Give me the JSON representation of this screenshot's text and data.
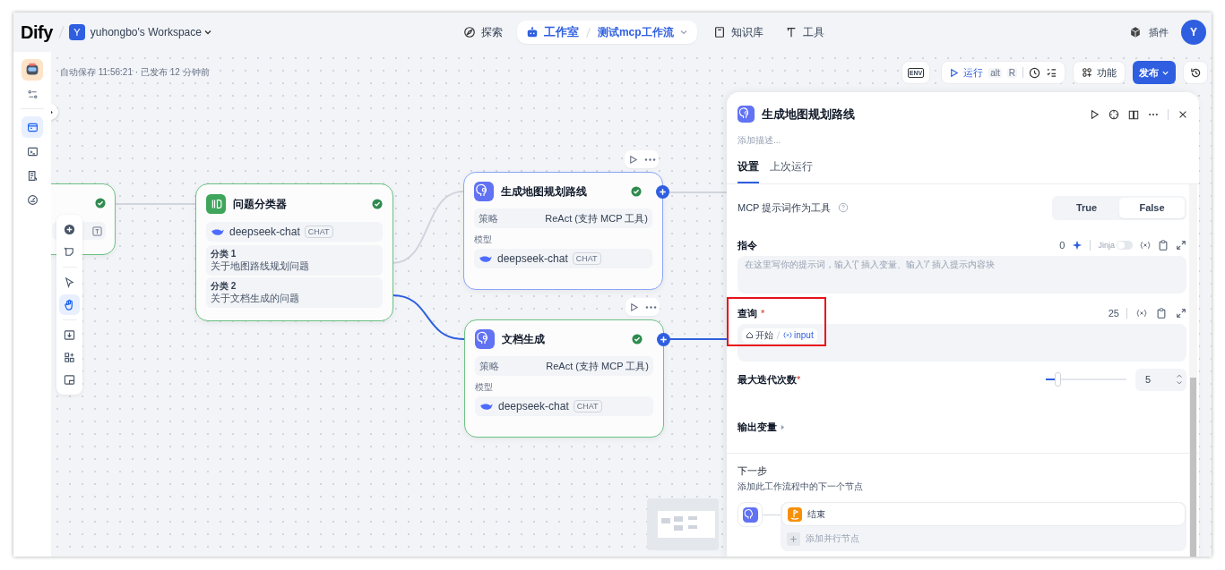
{
  "header": {
    "logo": "Dify",
    "workspace": {
      "initial": "Y",
      "name": "yuhongbo's Workspace"
    },
    "nav": [
      {
        "kind": "explore",
        "label": "探索",
        "selected": false
      },
      {
        "kind": "studio",
        "label": "工作室",
        "selected": true
      },
      {
        "kind": "knowledge",
        "label": "知识库",
        "selected": false
      },
      {
        "kind": "tools",
        "label": "工具",
        "selected": false
      }
    ],
    "breadcrumb": "测试mcp工作流",
    "plugins": "插件",
    "avatar": "Y"
  },
  "status": "自动保存 11:56:21 · 已发布 12 分钟前",
  "toolbar": {
    "env": "ENV",
    "run": "运行",
    "shortcut": [
      "alt",
      "R"
    ],
    "features": "功能",
    "publish": "发布"
  },
  "rail": [
    {
      "kind": "workflow",
      "selected": true
    },
    {
      "kind": "logs",
      "selected": false
    },
    {
      "kind": "annotations",
      "selected": false
    },
    {
      "kind": "monitor",
      "selected": false
    }
  ],
  "palette": [
    {
      "kind": "add",
      "selected": false
    },
    {
      "kind": "note",
      "selected": false
    },
    {
      "kind": "pointer",
      "selected": false
    },
    {
      "kind": "hand",
      "selected": true
    },
    {
      "kind": "export",
      "selected": false
    },
    {
      "kind": "layout",
      "selected": false
    },
    {
      "kind": "minimap",
      "selected": false
    }
  ],
  "nodes": {
    "start": {
      "succeeded": true
    },
    "classifier": {
      "title": "问题分类器",
      "succeeded": true,
      "model": "deepseek-chat",
      "tag": "CHAT",
      "classes": [
        {
          "label": "分类 1",
          "text": "关于地图路线规划问题"
        },
        {
          "label": "分类 2",
          "text": "关于文档生成的问题"
        }
      ]
    },
    "agents": [
      {
        "title": "生成地图规划路线",
        "selected": true,
        "succeeded": true,
        "strategy_label": "策略",
        "strategy": "ReAct (支持 MCP 工具)",
        "model_label": "模型",
        "model": "deepseek-chat",
        "tag": "CHAT"
      },
      {
        "title": "文档生成",
        "selected": false,
        "succeeded": true,
        "strategy_label": "策略",
        "strategy": "ReAct (支持 MCP 工具)",
        "model_label": "模型",
        "model": "deepseek-chat",
        "tag": "CHAT"
      }
    ]
  },
  "panel": {
    "title": "生成地图规划路线",
    "description_placeholder": "添加描述...",
    "tabs": [
      {
        "label": "设置",
        "selected": true
      },
      {
        "label": "上次运行",
        "selected": false
      }
    ],
    "mcp": {
      "label": "MCP 提示词作为工具",
      "options": [
        {
          "label": "True",
          "selected": false
        },
        {
          "label": "False",
          "selected": true
        }
      ]
    },
    "instruction": {
      "label": "指令",
      "count": "0",
      "jinja": "Jinja",
      "jinja_on": false,
      "placeholder": "在这里写你的提示词，输入'{' 插入变量、输入'/' 插入提示内容块"
    },
    "query": {
      "label": "查询",
      "required_mark": "*",
      "count": "25",
      "highlighted": true,
      "token": {
        "node": "开始",
        "variable": "input"
      }
    },
    "max_iterations": {
      "label": "最大迭代次数",
      "required_mark": "*",
      "level": 0.15,
      "value": "5"
    },
    "output": {
      "label": "输出变量"
    },
    "next_step": {
      "label": "下一步",
      "description": "添加此工作流程中的下一个节点",
      "next": "结束",
      "add": "添加并行节点"
    }
  }
}
